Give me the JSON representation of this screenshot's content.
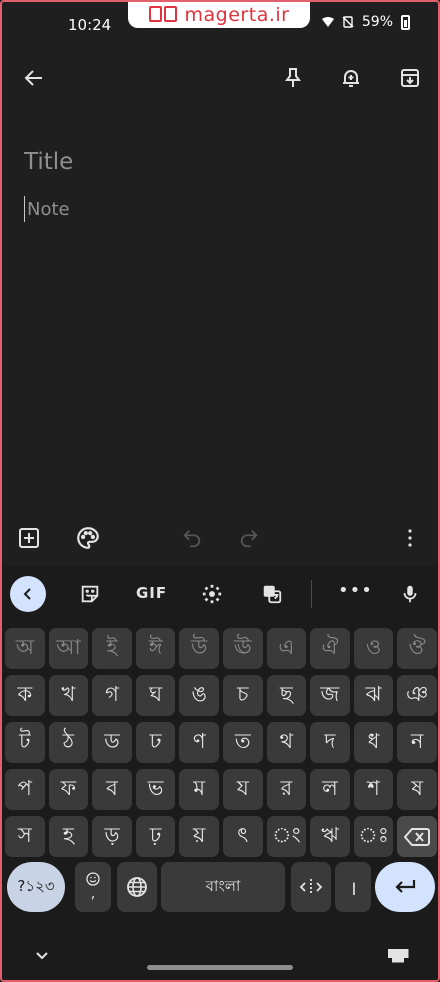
{
  "status": {
    "time": "10:24",
    "battery": "59%",
    "watermark": "magerta.ir"
  },
  "toolbar": {
    "back_icon": "arrow-back-icon",
    "pin_icon": "pin-icon",
    "reminder_icon": "bell-add-icon",
    "archive_icon": "archive-icon"
  },
  "editor": {
    "title_placeholder": "Title",
    "note_placeholder": "Note"
  },
  "note_bar": {
    "add_icon": "add-box-icon",
    "palette_icon": "palette-icon",
    "undo_icon": "undo-icon",
    "redo_icon": "redo-icon",
    "more_icon": "more-vert-icon"
  },
  "keyboard": {
    "suggestion": {
      "gif_label": "GIF",
      "more_label": "•••"
    },
    "rows": [
      [
        "অ",
        "আ",
        "ই",
        "ঈ",
        "উ",
        "ঊ",
        "এ",
        "ঐ",
        "ও",
        "ঔ"
      ],
      [
        "ক",
        "খ",
        "গ",
        "ঘ",
        "ঙ",
        "চ",
        "ছ",
        "জ",
        "ঝ",
        "ঞ"
      ],
      [
        "ট",
        "ঠ",
        "ড",
        "ঢ",
        "ণ",
        "ত",
        "থ",
        "দ",
        "ধ",
        "ন"
      ],
      [
        "প",
        "ফ",
        "ব",
        "ভ",
        "ম",
        "য",
        "র",
        "ল",
        "শ",
        "ষ"
      ],
      [
        "স",
        "হ",
        "ড়",
        "ঢ়",
        "য়",
        "ৎ",
        "ং",
        "ঋ",
        "ঃ"
      ]
    ],
    "symbols_label": "?১২৩",
    "emoji_comma": ",",
    "space_label": "বাংলা",
    "danda_label": "।"
  }
}
